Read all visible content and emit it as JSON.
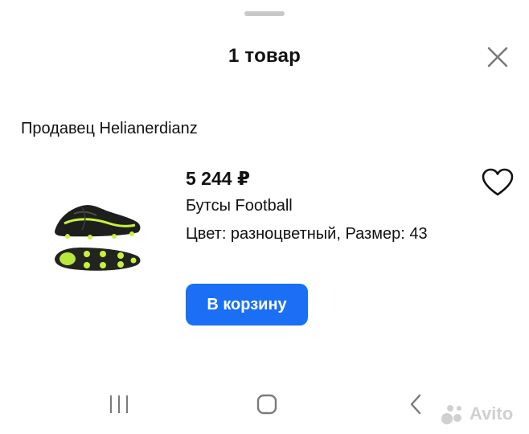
{
  "sheet": {
    "title": "1 товар",
    "seller_label": "Продавец Helianerdianz"
  },
  "item": {
    "price": "5 244 ₽",
    "name": "Бутсы Football",
    "attributes": "Цвет: разноцветный, Размер: 43",
    "image_icon": "football-boots-image",
    "cart_button_label": "В корзину",
    "favorite_icon": "heart-outline-icon"
  },
  "navbar": {
    "recent_icon": "recent-apps-icon",
    "home_icon": "home-icon",
    "back_icon": "back-icon"
  },
  "watermark": {
    "text": "Avito"
  },
  "colors": {
    "accent": "#1a6ff5",
    "grabber": "#c9c9c9",
    "icon_gray": "#7a7a7a",
    "text": "#111111"
  }
}
